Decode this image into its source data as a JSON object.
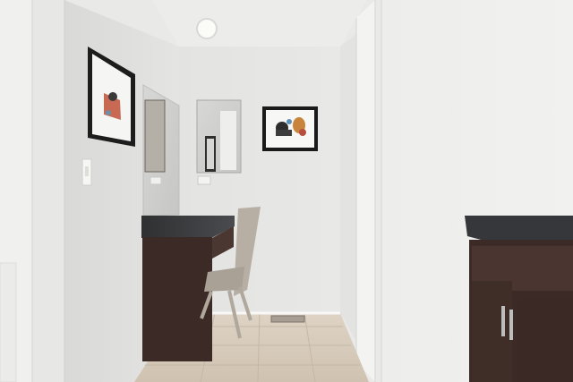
{
  "scene": {
    "description_visible_text": "",
    "colors": {
      "wall_light": "#e6e6e4",
      "wall_mid": "#dcdcda",
      "ceiling": "#ececea",
      "door_white": "#f3f3f1",
      "cabinet_dark": "#3b2a26",
      "countertop": "#3a3b3d",
      "floor_tile": "#d9cdbd",
      "chair": "#b9b1a6",
      "frame_black": "#1b1b1b"
    },
    "icons": [
      "ceiling-light-icon",
      "light-switch-icon",
      "outlet-icon",
      "floor-vent-icon",
      "cabinet-handle-icon"
    ]
  }
}
